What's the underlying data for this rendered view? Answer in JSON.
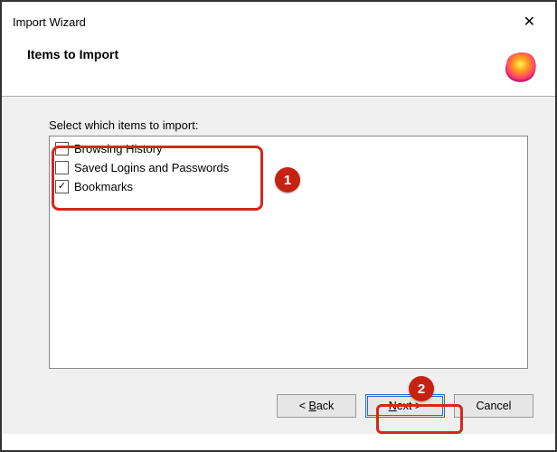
{
  "window": {
    "title": "Import Wizard",
    "close_symbol": "✕"
  },
  "header": {
    "heading": "Items to Import"
  },
  "content": {
    "prompt": "Select which items to import:",
    "items": [
      {
        "label": "Browsing History",
        "checked": false
      },
      {
        "label": "Saved Logins and Passwords",
        "checked": false
      },
      {
        "label": "Bookmarks",
        "checked": true
      }
    ]
  },
  "footer": {
    "back": {
      "pre": "< ",
      "accel": "B",
      "rest": "ack"
    },
    "next": {
      "accel": "N",
      "rest": "ext >"
    },
    "cancel": {
      "label": "Cancel"
    }
  },
  "annotations": {
    "marker1": "1",
    "marker2": "2"
  }
}
